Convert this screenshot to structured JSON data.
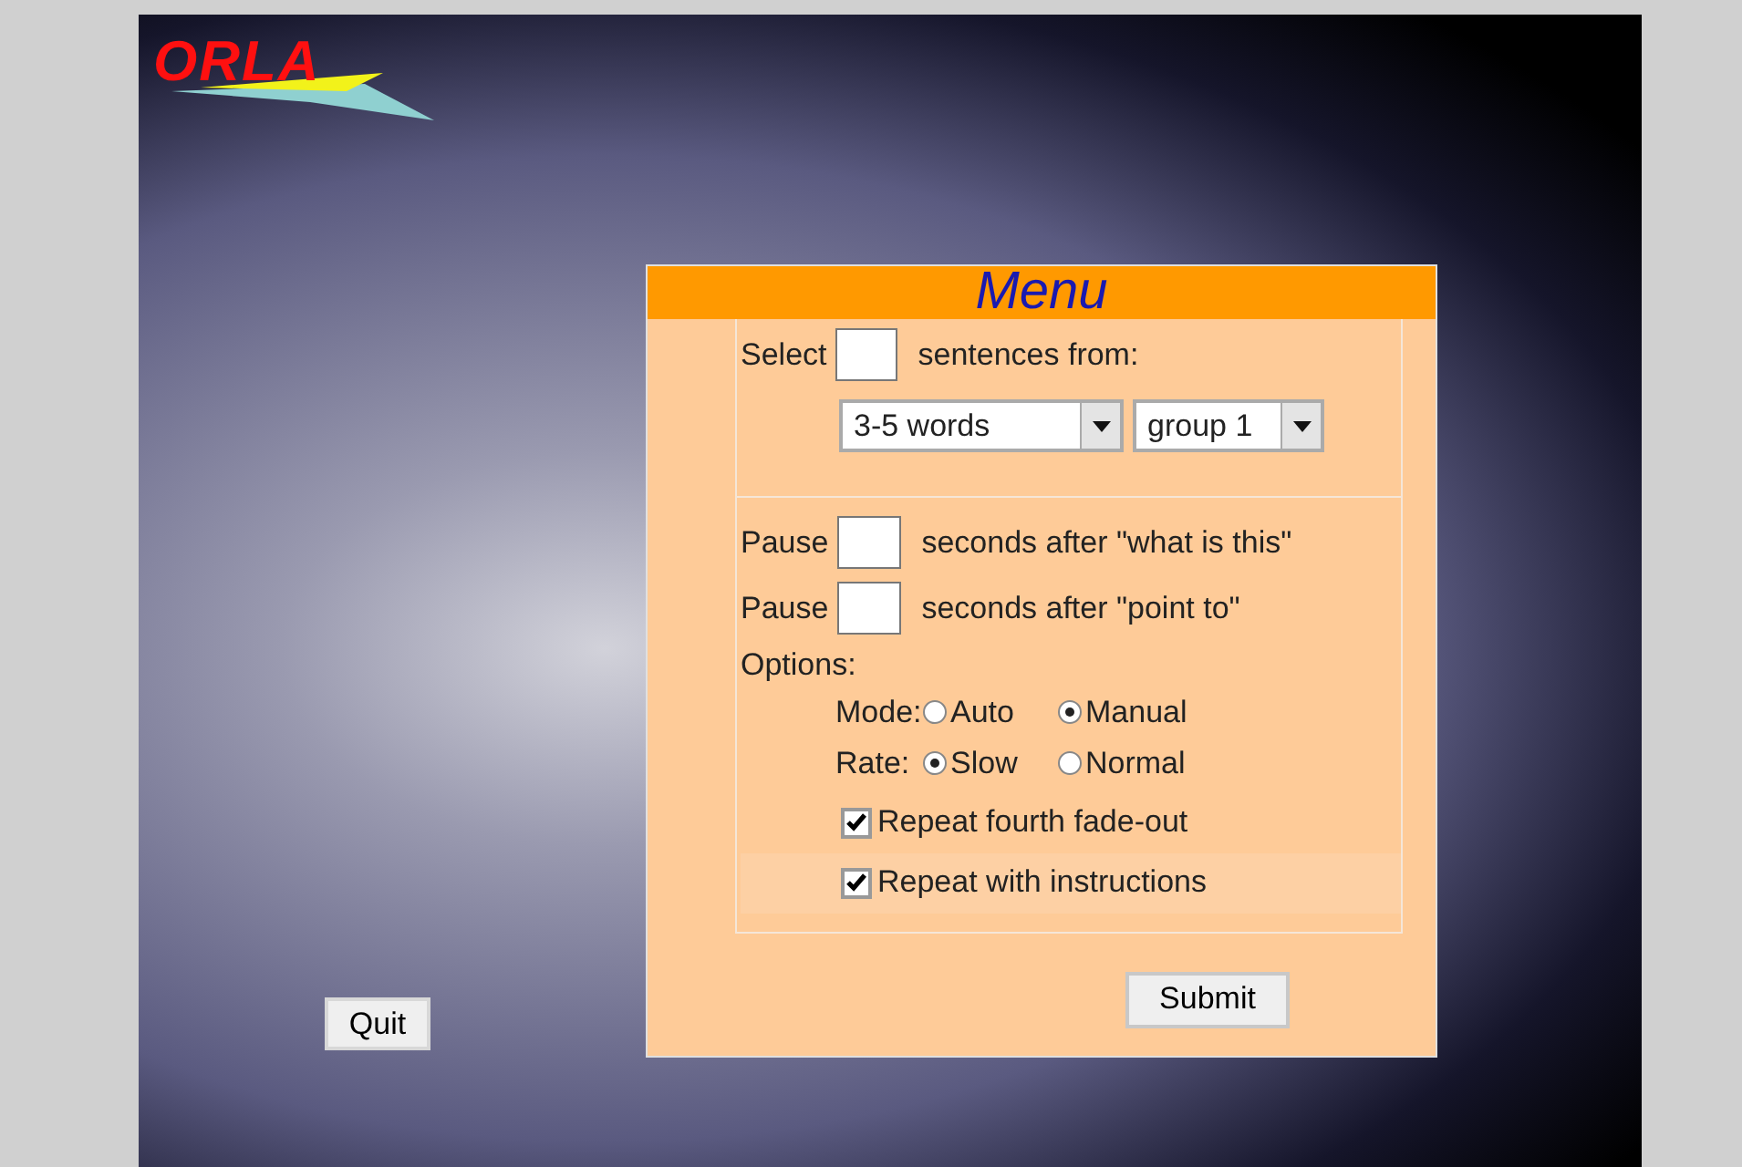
{
  "logo": {
    "text": "ORLA"
  },
  "menu": {
    "title": "Menu",
    "select_label": "Select",
    "select_suffix": "sentences from:",
    "dropdowns": [
      {
        "value": "3-5 words"
      },
      {
        "value": "group 1"
      }
    ],
    "pauses": [
      {
        "label": "Pause",
        "suffix": "seconds after \"what is this\""
      },
      {
        "label": "Pause",
        "suffix": "seconds after \"point to\""
      }
    ],
    "options_label": "Options:",
    "radio_groups": [
      {
        "label": "Mode:",
        "options": [
          {
            "label": "Auto",
            "selected": false
          },
          {
            "label": "Manual",
            "selected": true
          }
        ]
      },
      {
        "label": "Rate:",
        "options": [
          {
            "label": "Slow",
            "selected": true
          },
          {
            "label": "Normal",
            "selected": false
          }
        ]
      }
    ],
    "checkboxes": [
      {
        "label": "Repeat fourth fade-out",
        "checked": true
      },
      {
        "label": "Repeat with instructions",
        "checked": true
      }
    ],
    "submit": "Submit"
  },
  "quit": "Quit"
}
